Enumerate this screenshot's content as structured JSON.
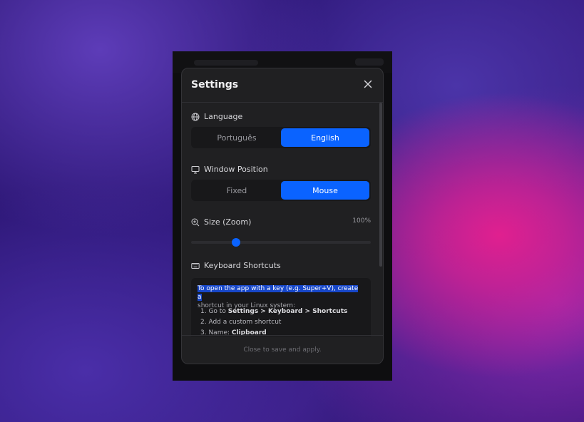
{
  "modal": {
    "title": "Settings",
    "close_icon": "close-icon",
    "footer_note": "Close to save and apply."
  },
  "language": {
    "label": "Language",
    "icon": "globe-icon",
    "options": [
      "Português",
      "English"
    ],
    "selected": "English"
  },
  "window_position": {
    "label": "Window Position",
    "icon": "monitor-icon",
    "options": [
      "Fixed",
      "Mouse"
    ],
    "selected": "Mouse"
  },
  "zoom": {
    "label": "Size (Zoom)",
    "icon": "zoom-in-icon",
    "value_text": "100%",
    "slider_fraction": 0.25
  },
  "shortcuts": {
    "label": "Keyboard Shortcuts",
    "icon": "keyboard-icon",
    "intro_highlighted": "To open the app with a key (e.g. Super+V), create a",
    "intro_rest": "shortcut in your Linux system:",
    "steps": [
      {
        "prefix": "1. Go to ",
        "bold": "Settings > Keyboard > Shortcuts"
      },
      {
        "prefix": "2. Add a custom shortcut",
        "bold": ""
      },
      {
        "prefix": "3. Name: ",
        "bold": "Clipboard"
      }
    ]
  },
  "colors": {
    "accent": "#0a63ff",
    "modal_bg": "#202022",
    "highlight": "#1747c9"
  }
}
